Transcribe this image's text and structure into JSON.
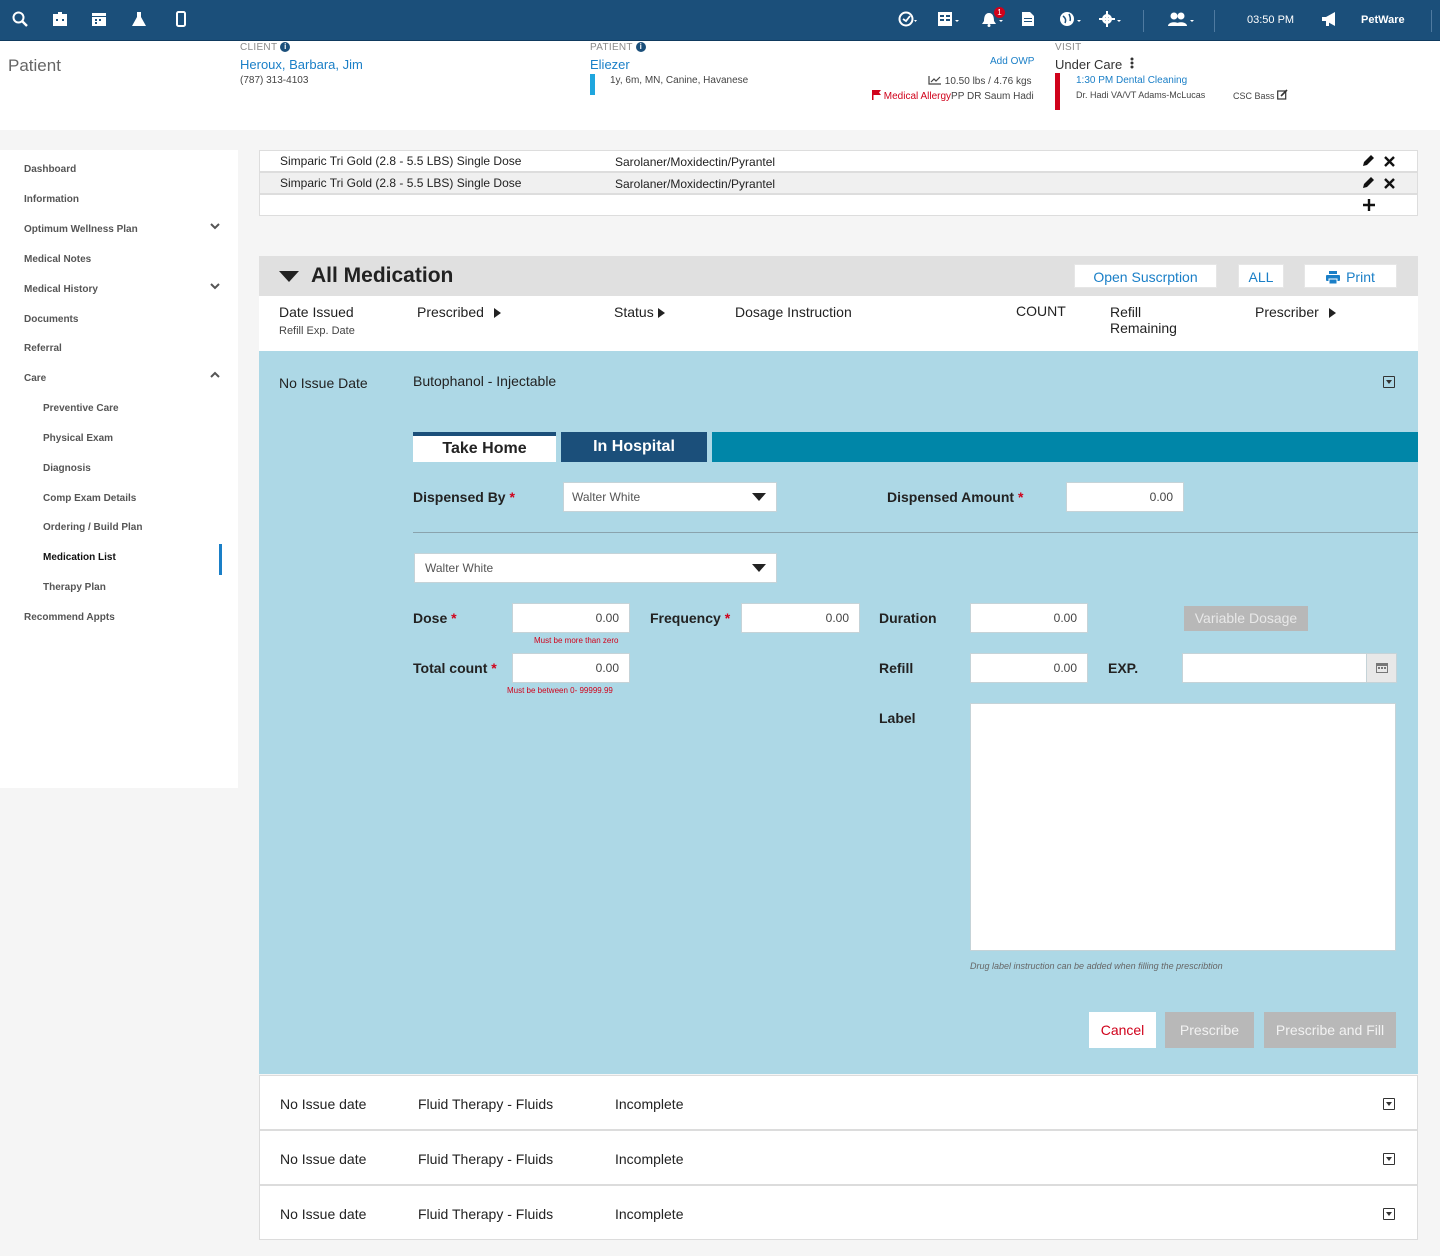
{
  "topbar": {
    "time": "03:50 PM",
    "brand": "PetWare",
    "notification_count": "1"
  },
  "header": {
    "page_title": "Patient",
    "client": {
      "label": "CLIENT",
      "name": "Heroux, Barbara, Jim",
      "phone": "(787) 313-4103"
    },
    "patient": {
      "label": "PATIENT",
      "name": "Eliezer",
      "details": "1y, 6m, MN, Canine, Havanese",
      "add_owp": "Add OWP",
      "weight": "10.50 lbs / 4.76 kgs",
      "allergy": "Medical Allergy",
      "allergy_suffix": "PP DR Saum Hadi"
    },
    "visit": {
      "label": "VISIT",
      "status": "Under Care",
      "appointment": "1:30 PM Dental Cleaning",
      "doctors": "Dr. Hadi VA/VT Adams-McLucas",
      "csc": "CSC Bass"
    }
  },
  "sidebar": {
    "items": [
      {
        "label": "Dashboard"
      },
      {
        "label": "Information"
      },
      {
        "label": "Optimum Wellness Plan"
      },
      {
        "label": "Medical Notes"
      },
      {
        "label": "Medical History"
      },
      {
        "label": "Documents"
      },
      {
        "label": "Referral"
      },
      {
        "label": "Care"
      },
      {
        "label": "Preventive Care"
      },
      {
        "label": "Physical Exam"
      },
      {
        "label": "Diagnosis"
      },
      {
        "label": "Comp Exam Details"
      },
      {
        "label": "Ordering / Build Plan"
      },
      {
        "label": "Medication List"
      },
      {
        "label": "Therapy Plan"
      },
      {
        "label": "Recommend Appts"
      }
    ]
  },
  "products": [
    {
      "name": "Simparic Tri Gold (2.8 - 5.5 LBS) Single Dose",
      "ingredient": "Sarolaner/Moxidectin/Pyrantel"
    },
    {
      "name": "Simparic Tri Gold (2.8 - 5.5 LBS) Single Dose",
      "ingredient": "Sarolaner/Moxidectin/Pyrantel"
    }
  ],
  "medication": {
    "title": "All Medication",
    "open_subscription": "Open Suscrption",
    "all": "ALL",
    "print": "Print",
    "columns": {
      "date_issued": "Date Issued",
      "refill_exp": "Refill Exp. Date",
      "prescribed": "Prescribed",
      "status": "Status",
      "dosage": "Dosage Instruction",
      "count": "COUNT",
      "refill_1": "Refill",
      "refill_2": "Remaining",
      "prescriber": "Prescriber"
    }
  },
  "panel": {
    "issue_date": "No Issue Date",
    "drug": "Butophanol - Injectable",
    "tabs": {
      "take_home": "Take Home",
      "in_hospital": "In Hospital"
    },
    "dispensed_by_label": "Dispensed By",
    "dispensed_by_value": "Walter White",
    "dispensed_amount_label": "Dispensed Amount",
    "dispensed_amount_value": "0.00",
    "second_select": "Walter White",
    "dose_label": "Dose",
    "dose_value": "0.00",
    "dose_error": "Must be more than zero",
    "frequency_label": "Frequency",
    "frequency_value": "0.00",
    "duration_label": "Duration",
    "duration_value": "0.00",
    "variable_dosage": "Variable Dosage",
    "total_count_label": "Total count",
    "total_count_value": "0.00",
    "total_count_error": "Must be  between  0- 99999.99",
    "refill_label": "Refill",
    "refill_value": "0.00",
    "exp_label": "EXP.",
    "label_label": "Label",
    "label_hint": "Drug label  instruction can be added when filling the prescribtion",
    "cancel": "Cancel",
    "prescribe": "Prescribe",
    "prescribe_fill": "Prescribe and Fill"
  },
  "list": [
    {
      "date": "No Issue date",
      "item": "Fluid Therapy - Fluids",
      "status": "Incomplete"
    },
    {
      "date": "No Issue date",
      "item": "Fluid Therapy - Fluids",
      "status": "Incomplete"
    },
    {
      "date": "No Issue date",
      "item": "Fluid Therapy - Fluids",
      "status": "Incomplete"
    }
  ]
}
